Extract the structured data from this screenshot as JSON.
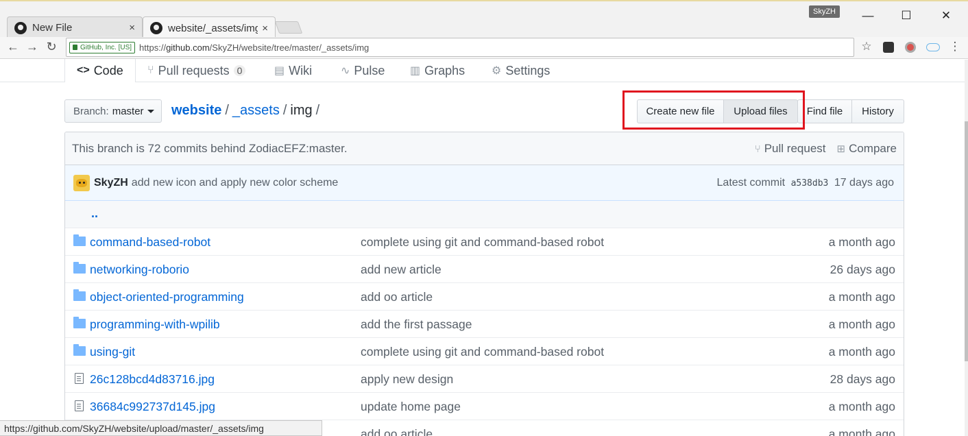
{
  "browser": {
    "tabs": [
      {
        "title": "New File",
        "close": "×"
      },
      {
        "title": "website/_assets/img",
        "close": "×"
      }
    ],
    "profile": "SkyZH",
    "window_controls": {
      "minimize": "—",
      "maximize": "☐",
      "close": "✕"
    },
    "nav": {
      "back": "←",
      "forward": "→",
      "reload": "↻"
    },
    "security_label": "GitHub, Inc. [US]",
    "url_scheme": "https://",
    "url_host": "github.com",
    "url_path": "/SkyZH/website/tree/master/_assets/img",
    "bookmark_star": "☆",
    "menu": "⋮",
    "status_url": "https://github.com/SkyZH/website/upload/master/_assets/img"
  },
  "repo_nav": {
    "code": {
      "icon": "<>",
      "label": "Code"
    },
    "pull_requests": {
      "icon": "⑂",
      "label": "Pull requests",
      "count": "0"
    },
    "wiki": {
      "icon": "▤",
      "label": "Wiki"
    },
    "pulse": {
      "icon": "∿",
      "label": "Pulse"
    },
    "graphs": {
      "icon": "▥",
      "label": "Graphs"
    },
    "settings": {
      "icon": "⚙",
      "label": "Settings"
    }
  },
  "branch": {
    "prefix": "Branch:",
    "name": "master"
  },
  "breadcrumb": {
    "repo": "website",
    "sep1": "/",
    "dir1": "_assets",
    "sep2": "/",
    "current": "img",
    "sep3": "/"
  },
  "file_actions": {
    "create": "Create new file",
    "upload": "Upload files",
    "find": "Find file",
    "history": "History"
  },
  "branch_info": {
    "text": "This branch is 72 commits behind ZodiacEFZ:master.",
    "pull_request": "Pull request",
    "compare": "Compare"
  },
  "latest_commit": {
    "author": "SkyZH",
    "message": "add new icon and apply new color scheme",
    "prefix": "Latest commit",
    "sha": "a538db3",
    "age": "17 days ago"
  },
  "updir": "..",
  "files": [
    {
      "type": "dir",
      "name": "command-based-robot",
      "message": "complete using git and command-based robot",
      "age": "a month ago"
    },
    {
      "type": "dir",
      "name": "networking-roborio",
      "message": "add new article",
      "age": "26 days ago"
    },
    {
      "type": "dir",
      "name": "object-oriented-programming",
      "message": "add oo article",
      "age": "a month ago"
    },
    {
      "type": "dir",
      "name": "programming-with-wpilib",
      "message": "add the first passage",
      "age": "a month ago"
    },
    {
      "type": "dir",
      "name": "using-git",
      "message": "complete using git and command-based robot",
      "age": "a month ago"
    },
    {
      "type": "file",
      "name": "26c128bcd4d83716.jpg",
      "message": "apply new design",
      "age": "28 days ago"
    },
    {
      "type": "file",
      "name": "36684c992737d145.jpg",
      "message": "update home page",
      "age": "a month ago"
    },
    {
      "type": "file",
      "name": "",
      "message": "add oo article",
      "age": "a month ago"
    }
  ]
}
